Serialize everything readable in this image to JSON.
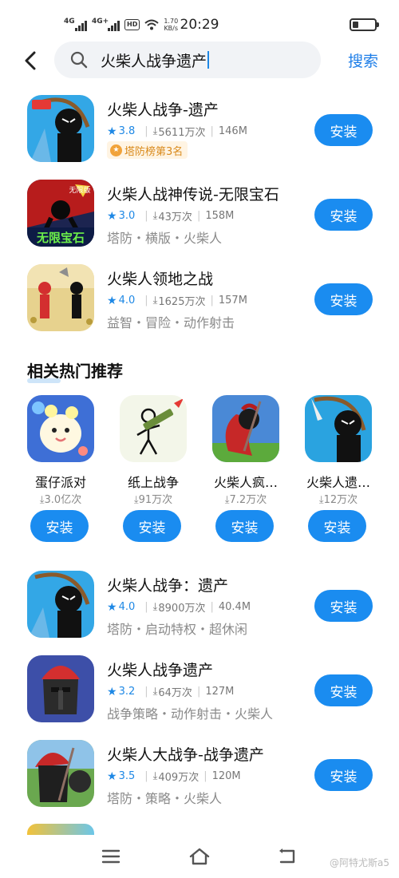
{
  "status_bar": {
    "signal1_label": "4G",
    "signal2_label": "4G+",
    "hd_label": "HD",
    "speed_value": "1.70",
    "speed_unit": "KB/s",
    "time": "20:29",
    "battery_icon": "battery-low-icon"
  },
  "search": {
    "back_icon": "chevron-left-icon",
    "search_icon": "magnifier-icon",
    "query": "火柴人战争遗产",
    "button_label": "搜索"
  },
  "results": [
    {
      "name": "火柴人战争-遗产",
      "rating": "3.8",
      "downloads": "5611万次",
      "size": "146M",
      "badge": "塔防榜第3名",
      "tags": "",
      "install": "安装"
    },
    {
      "name": "火柴人战神传说-无限宝石",
      "rating": "3.0",
      "downloads": "43万次",
      "size": "158M",
      "badge": "",
      "tags": "塔防・横版・火柴人",
      "install": "安装",
      "icon_text": "无限宝石",
      "icon_subtext": "无限版"
    },
    {
      "name": "火柴人领地之战",
      "rating": "4.0",
      "downloads": "1625万次",
      "size": "157M",
      "badge": "",
      "tags": "益智・冒险・动作射击",
      "install": "安装"
    }
  ],
  "related": {
    "title": "相关热门推荐",
    "items": [
      {
        "name": "蛋仔派对",
        "downloads": "3.0亿次",
        "install": "安装"
      },
      {
        "name": "纸上战争",
        "downloads": "91万次",
        "install": "安装"
      },
      {
        "name": "火柴人疯…",
        "downloads": "7.2万次",
        "install": "安装"
      },
      {
        "name": "火柴人遗…",
        "downloads": "12万次",
        "install": "安装"
      }
    ]
  },
  "more_results": [
    {
      "name": "火柴人战争：遗产",
      "rating": "4.0",
      "downloads": "8900万次",
      "size": "40.4M",
      "tags": "塔防・启动特权・超休闲",
      "install": "安装"
    },
    {
      "name": "火柴人战争遗产",
      "rating": "3.2",
      "downloads": "64万次",
      "size": "127M",
      "tags": "战争策略・动作射击・火柴人",
      "install": "安装"
    },
    {
      "name": "火柴人大战争-战争遗产",
      "rating": "3.5",
      "downloads": "409万次",
      "size": "120M",
      "tags": "塔防・策略・火柴人",
      "install": "安装"
    }
  ],
  "nav": {
    "menu_icon": "menu-icon",
    "home_icon": "home-icon",
    "back_icon": "return-icon"
  },
  "watermark": "@阿特尤斯a5",
  "colors": {
    "accent": "#1a8cf0",
    "link": "#1e7ee8",
    "badge_bg": "#fff4e3",
    "badge_text": "#d98a1c"
  }
}
